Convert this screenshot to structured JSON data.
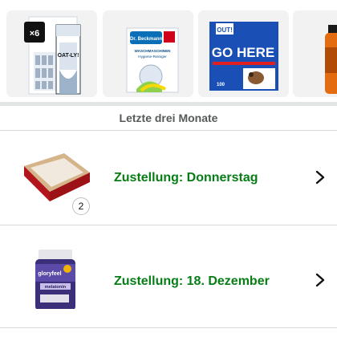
{
  "carousel": {
    "items": [
      {
        "name": "oatly-pack-image",
        "badge": "×6",
        "brand": "OAT-LY!"
      },
      {
        "name": "dr-beckmann-image",
        "brand": "Dr. Beckmann",
        "line1": "WASCHMASCHINEN",
        "line2": "Hygiene-Reiniger"
      },
      {
        "name": "go-here-image",
        "brand": "OUT!",
        "title": "GO HERE",
        "count": "100"
      },
      {
        "name": "orange-bottle-image"
      }
    ]
  },
  "section": {
    "header": "Letzte drei Monate"
  },
  "orders": [
    {
      "status": "Zustellung: Donnerstag",
      "quantity": "2"
    },
    {
      "status": "Zustellung: 18. Dezember",
      "product_brand": "gloryfeel",
      "product_label": "melatonin"
    }
  ],
  "colors": {
    "status_green": "#067d15",
    "header_gray": "#565959",
    "card_bg": "#f2f2f2"
  }
}
